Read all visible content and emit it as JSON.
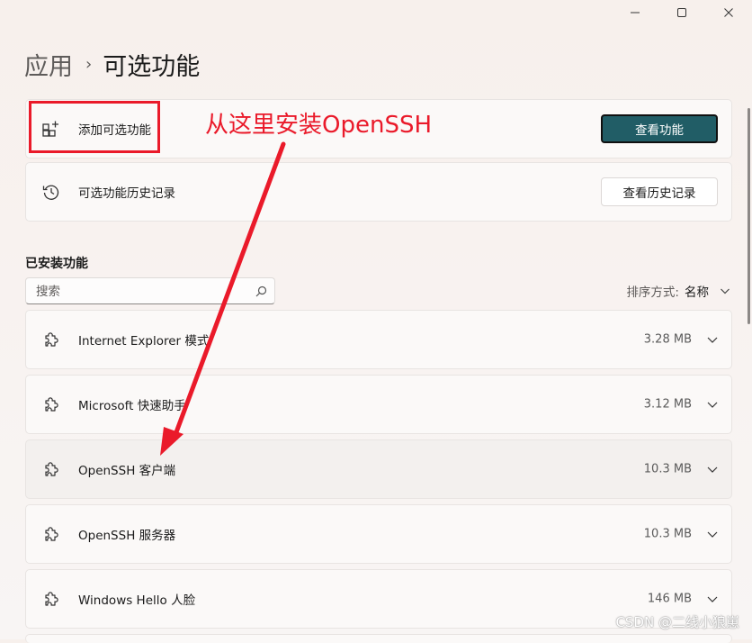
{
  "window": {
    "minimize_icon": "minimize-icon",
    "maximize_icon": "maximize-icon",
    "close_icon": "close-icon"
  },
  "breadcrumb": {
    "parent": "应用",
    "separator": "›",
    "current": "可选功能"
  },
  "add_card": {
    "label": "添加可选功能",
    "button": "查看功能",
    "icon": "add-apps-icon"
  },
  "history_card": {
    "label": "可选功能历史记录",
    "button": "查看历史记录",
    "icon": "history-icon"
  },
  "installed": {
    "title": "已安装功能",
    "search_placeholder": "搜索",
    "sort_label": "排序方式:",
    "sort_value": "名称",
    "items": [
      {
        "name": "Internet Explorer 模式",
        "size": "3.28 MB"
      },
      {
        "name": "Microsoft 快速助手",
        "size": "3.12 MB"
      },
      {
        "name": "OpenSSH 客户端",
        "size": "10.3 MB"
      },
      {
        "name": "OpenSSH 服务器",
        "size": "10.3 MB"
      },
      {
        "name": "Windows Hello 人脸",
        "size": "146 MB"
      }
    ]
  },
  "annotation": {
    "text": "从这里安装OpenSSH",
    "color": "#ea1a2a"
  },
  "watermark": "CSDN @二线小狼崽",
  "colors": {
    "accent": "#215d66",
    "background": "#f7f2ef"
  }
}
